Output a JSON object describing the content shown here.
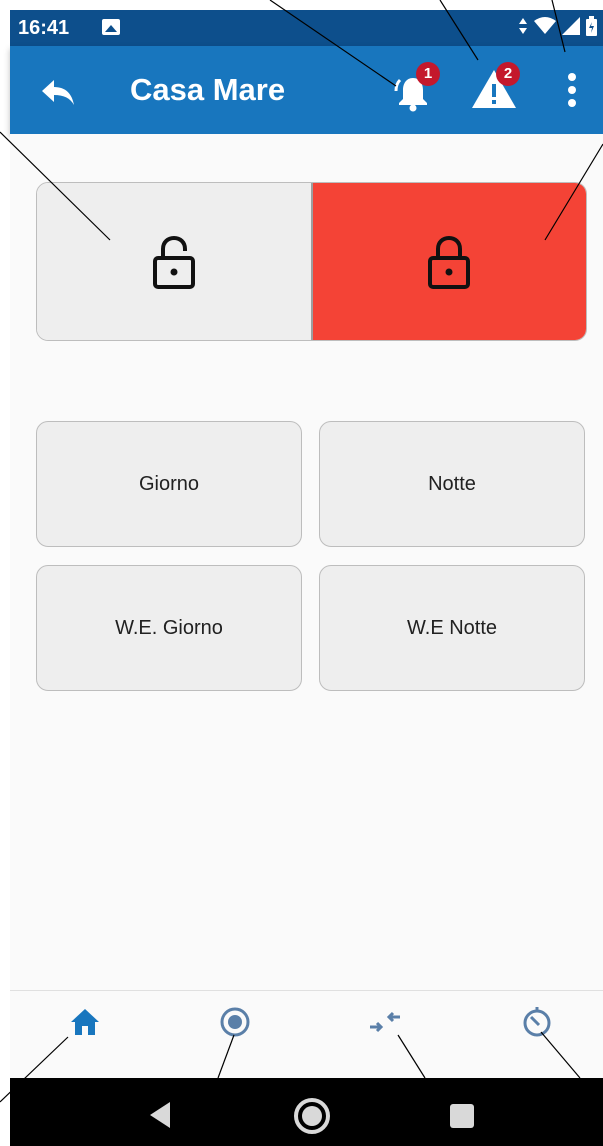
{
  "status_bar": {
    "time": "16:41"
  },
  "app_bar": {
    "title": "Casa Mare",
    "notifications_badge": "1",
    "warnings_badge": "2"
  },
  "mode_buttons": [
    "Giorno",
    "Notte",
    "W.E. Giorno",
    "W.E Notte"
  ],
  "colors": {
    "app_bar": "#1876be",
    "status_bar": "#0d4f8c",
    "locked_active": "#f44336",
    "badge": "#c4182c",
    "nav_active": "#1876be",
    "nav_inactive": "#5a7fa8"
  },
  "lock_states": {
    "unlocked": {
      "icon": "lock-open-icon",
      "selected": false
    },
    "locked": {
      "icon": "lock-closed-icon",
      "selected": true
    }
  },
  "bottom_nav": [
    {
      "icon": "home-icon",
      "active": true
    },
    {
      "icon": "radio-button-icon",
      "active": false
    },
    {
      "icon": "compare-arrows-icon",
      "active": false
    },
    {
      "icon": "timer-icon",
      "active": false
    }
  ],
  "system_nav": [
    "back-triangle-icon",
    "home-circle-icon",
    "recents-square-icon"
  ]
}
